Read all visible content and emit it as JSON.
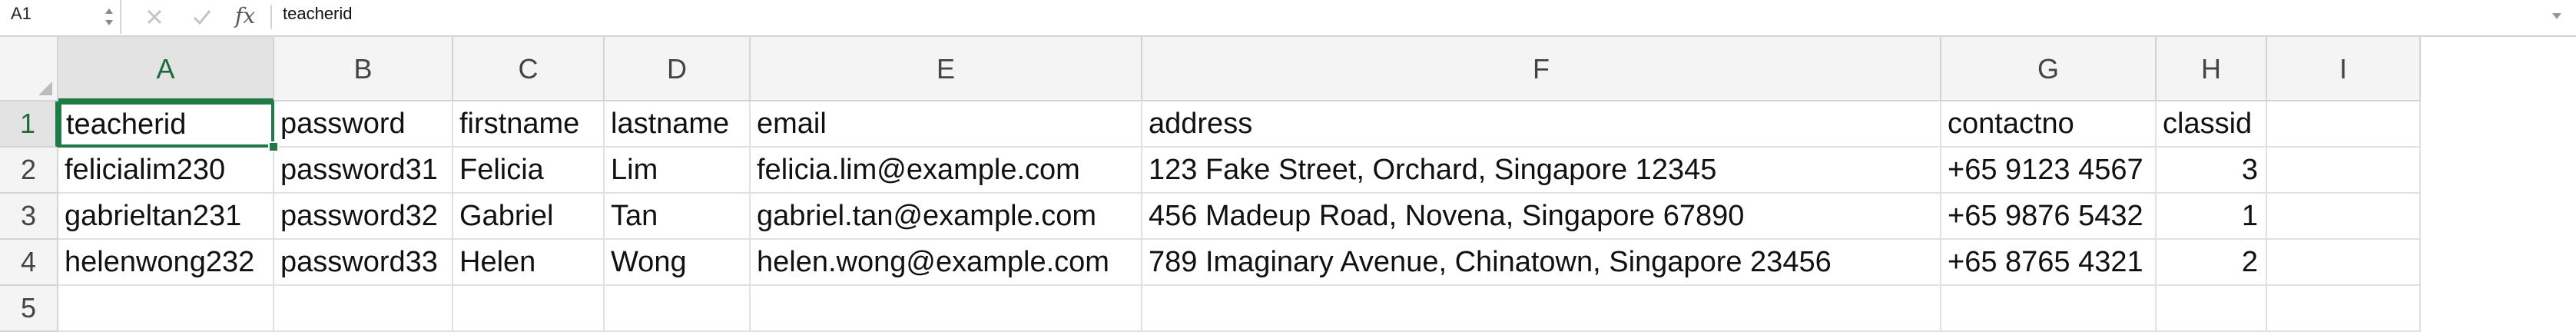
{
  "formula_bar": {
    "name_box": "A1",
    "stepper": "▲▼",
    "fx": "fx",
    "content": "teacherid"
  },
  "icons": {
    "cancel": "cancel-x-icon",
    "confirm": "confirm-check-icon",
    "fx": "function-icon",
    "expand": "chevron-down-icon"
  },
  "colors": {
    "accent": "#1e7b45",
    "header_bg": "#f4f4f4",
    "grid_line": "#e1e1e1"
  },
  "columns": [
    "A",
    "B",
    "C",
    "D",
    "E",
    "F",
    "G",
    "H",
    "I"
  ],
  "rows": [
    "1",
    "2",
    "3",
    "4",
    "5"
  ],
  "cells": [
    [
      "teacherid",
      "password",
      "firstname",
      "lastname",
      "email",
      "address",
      "contactno",
      "classid",
      ""
    ],
    [
      "felicialim230",
      "password31",
      "Felicia",
      "Lim",
      "felicia.lim@example.com",
      "123 Fake Street, Orchard, Singapore 12345",
      "+65 9123 4567",
      "3",
      ""
    ],
    [
      "gabrieltan231",
      "password32",
      "Gabriel",
      "Tan",
      "gabriel.tan@example.com",
      "456 Madeup Road, Novena, Singapore 67890",
      "+65 9876 5432",
      "1",
      ""
    ],
    [
      "helenwong232",
      "password33",
      "Helen",
      "Wong",
      "helen.wong@example.com",
      "789 Imaginary Avenue, Chinatown, Singapore 23456",
      "+65 8765 4321",
      "2",
      ""
    ],
    [
      "",
      "",
      "",
      "",
      "",
      "",
      "",
      "",
      ""
    ]
  ],
  "selected_cell": "A1"
}
